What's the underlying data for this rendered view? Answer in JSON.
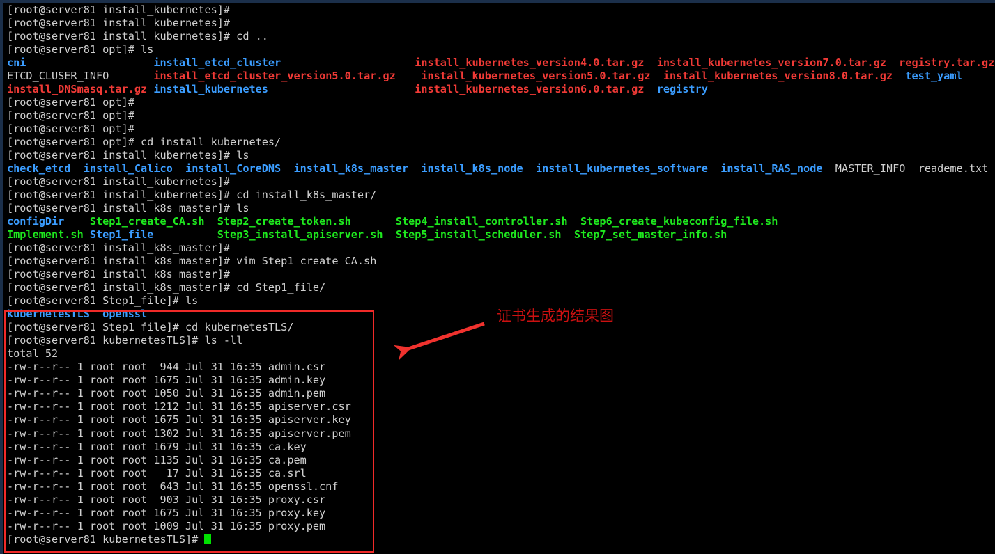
{
  "terminal": {
    "background_color": "#000000",
    "default_text_color": "#d0d0d0",
    "dir_color": "#3b9dff",
    "archive_color": "#f03a36",
    "exec_color": "#1ee81e",
    "cursor_color": "#00e000",
    "prompt_user_host": "[root@server81",
    "lines": [
      {
        "id": 1,
        "segments": [
          {
            "text": "[root@server81 install_kubernetes]#",
            "color": "white"
          }
        ]
      },
      {
        "id": 2,
        "segments": [
          {
            "text": "[root@server81 install_kubernetes]#",
            "color": "white"
          }
        ]
      },
      {
        "id": 3,
        "segments": [
          {
            "text": "[root@server81 install_kubernetes]# cd ..",
            "color": "white"
          }
        ]
      },
      {
        "id": 4,
        "segments": [
          {
            "text": "[root@server81 opt]# ls",
            "color": "white"
          }
        ]
      },
      {
        "id": 5,
        "segments": [
          {
            "text": "cni",
            "color": "blue"
          },
          {
            "text": "                    ",
            "color": "white"
          },
          {
            "text": "install_etcd_cluster",
            "color": "blue"
          },
          {
            "text": "                     ",
            "color": "white"
          },
          {
            "text": "install_kubernetes_version4.0.tar.gz",
            "color": "red"
          },
          {
            "text": "  ",
            "color": "white"
          },
          {
            "text": "install_kubernetes_version7.0.tar.gz",
            "color": "red"
          },
          {
            "text": "  ",
            "color": "white"
          },
          {
            "text": "registry.tar.gz",
            "color": "red"
          }
        ]
      },
      {
        "id": 6,
        "segments": [
          {
            "text": "ETCD_CLUSER_INFO",
            "color": "white"
          },
          {
            "text": "       ",
            "color": "white"
          },
          {
            "text": "install_etcd_cluster_version5.0.tar.gz",
            "color": "red"
          },
          {
            "text": "    ",
            "color": "white"
          },
          {
            "text": "install_kubernetes_version5.0.tar.gz",
            "color": "red"
          },
          {
            "text": "  ",
            "color": "white"
          },
          {
            "text": "install_kubernetes_version8.0.tar.gz",
            "color": "red"
          },
          {
            "text": "  ",
            "color": "white"
          },
          {
            "text": "test_yaml",
            "color": "blue"
          }
        ]
      },
      {
        "id": 7,
        "segments": [
          {
            "text": "install_DNSmasq.tar.gz",
            "color": "red"
          },
          {
            "text": " ",
            "color": "white"
          },
          {
            "text": "install_kubernetes",
            "color": "blue"
          },
          {
            "text": "                       ",
            "color": "white"
          },
          {
            "text": "install_kubernetes_version6.0.tar.gz",
            "color": "red"
          },
          {
            "text": "  ",
            "color": "white"
          },
          {
            "text": "registry",
            "color": "blue"
          }
        ]
      },
      {
        "id": 8,
        "segments": [
          {
            "text": "[root@server81 opt]#",
            "color": "white"
          }
        ]
      },
      {
        "id": 9,
        "segments": [
          {
            "text": "[root@server81 opt]#",
            "color": "white"
          }
        ]
      },
      {
        "id": 10,
        "segments": [
          {
            "text": "[root@server81 opt]#",
            "color": "white"
          }
        ]
      },
      {
        "id": 11,
        "segments": [
          {
            "text": "[root@server81 opt]# cd install_kubernetes/",
            "color": "white"
          }
        ]
      },
      {
        "id": 12,
        "segments": [
          {
            "text": "[root@server81 install_kubernetes]# ls",
            "color": "white"
          }
        ]
      },
      {
        "id": 13,
        "segments": [
          {
            "text": "check_etcd",
            "color": "blue"
          },
          {
            "text": "  ",
            "color": "white"
          },
          {
            "text": "install_Calico",
            "color": "blue"
          },
          {
            "text": "  ",
            "color": "white"
          },
          {
            "text": "install_CoreDNS",
            "color": "blue"
          },
          {
            "text": "  ",
            "color": "white"
          },
          {
            "text": "install_k8s_master",
            "color": "blue"
          },
          {
            "text": "  ",
            "color": "white"
          },
          {
            "text": "install_k8s_node",
            "color": "blue"
          },
          {
            "text": "  ",
            "color": "white"
          },
          {
            "text": "install_kubernetes_software",
            "color": "blue"
          },
          {
            "text": "  ",
            "color": "white"
          },
          {
            "text": "install_RAS_node",
            "color": "blue"
          },
          {
            "text": "  ",
            "color": "white"
          },
          {
            "text": "MASTER_INFO",
            "color": "white"
          },
          {
            "text": "  ",
            "color": "white"
          },
          {
            "text": "reademe.txt",
            "color": "white"
          }
        ]
      },
      {
        "id": 14,
        "segments": [
          {
            "text": "[root@server81 install_kubernetes]#",
            "color": "white"
          }
        ]
      },
      {
        "id": 15,
        "segments": [
          {
            "text": "[root@server81 install_kubernetes]# cd install_k8s_master/",
            "color": "white"
          }
        ]
      },
      {
        "id": 16,
        "segments": [
          {
            "text": "[root@server81 install_k8s_master]# ls",
            "color": "white"
          }
        ]
      },
      {
        "id": 17,
        "segments": [
          {
            "text": "configDir",
            "color": "blue"
          },
          {
            "text": "    ",
            "color": "white"
          },
          {
            "text": "Step1_create_CA.sh",
            "color": "green"
          },
          {
            "text": "  ",
            "color": "white"
          },
          {
            "text": "Step2_create_token.sh",
            "color": "green"
          },
          {
            "text": "       ",
            "color": "white"
          },
          {
            "text": "Step4_install_controller.sh",
            "color": "green"
          },
          {
            "text": "  ",
            "color": "white"
          },
          {
            "text": "Step6_create_kubeconfig_file.sh",
            "color": "green"
          }
        ]
      },
      {
        "id": 18,
        "segments": [
          {
            "text": "Implement.sh",
            "color": "green"
          },
          {
            "text": " ",
            "color": "white"
          },
          {
            "text": "Step1_file",
            "color": "blue"
          },
          {
            "text": "          ",
            "color": "white"
          },
          {
            "text": "Step3_install_apiserver.sh",
            "color": "green"
          },
          {
            "text": "  ",
            "color": "white"
          },
          {
            "text": "Step5_install_scheduler.sh",
            "color": "green"
          },
          {
            "text": "  ",
            "color": "white"
          },
          {
            "text": "Step7_set_master_info.sh",
            "color": "green"
          }
        ]
      },
      {
        "id": 19,
        "segments": [
          {
            "text": "[root@server81 install_k8s_master]#",
            "color": "white"
          }
        ]
      },
      {
        "id": 20,
        "segments": [
          {
            "text": "[root@server81 install_k8s_master]# vim Step1_create_CA.sh",
            "color": "white"
          }
        ]
      },
      {
        "id": 21,
        "segments": [
          {
            "text": "[root@server81 install_k8s_master]#",
            "color": "white"
          }
        ]
      },
      {
        "id": 22,
        "segments": [
          {
            "text": "[root@server81 install_k8s_master]# cd Step1_file/",
            "color": "white"
          }
        ]
      },
      {
        "id": 23,
        "segments": [
          {
            "text": "[root@server81 Step1_file]# ls",
            "color": "white"
          }
        ]
      },
      {
        "id": 24,
        "segments": [
          {
            "text": "kubernetesTLS",
            "color": "blue"
          },
          {
            "text": "  ",
            "color": "white"
          },
          {
            "text": "openssl",
            "color": "blue"
          }
        ]
      },
      {
        "id": 25,
        "segments": [
          {
            "text": "[root@server81 Step1_file]# cd kubernetesTLS/",
            "color": "white"
          }
        ]
      },
      {
        "id": 26,
        "segments": [
          {
            "text": "[root@server81 kubernetesTLS]# ls -ll",
            "color": "white"
          }
        ]
      },
      {
        "id": 27,
        "segments": [
          {
            "text": "total 52",
            "color": "white"
          }
        ]
      },
      {
        "id": 28,
        "segments": [
          {
            "text": "-rw-r--r-- 1 root root  944 Jul 31 16:35 admin.csr",
            "color": "white"
          }
        ]
      },
      {
        "id": 29,
        "segments": [
          {
            "text": "-rw-r--r-- 1 root root 1675 Jul 31 16:35 admin.key",
            "color": "white"
          }
        ]
      },
      {
        "id": 30,
        "segments": [
          {
            "text": "-rw-r--r-- 1 root root 1050 Jul 31 16:35 admin.pem",
            "color": "white"
          }
        ]
      },
      {
        "id": 31,
        "segments": [
          {
            "text": "-rw-r--r-- 1 root root 1212 Jul 31 16:35 apiserver.csr",
            "color": "white"
          }
        ]
      },
      {
        "id": 32,
        "segments": [
          {
            "text": "-rw-r--r-- 1 root root 1675 Jul 31 16:35 apiserver.key",
            "color": "white"
          }
        ]
      },
      {
        "id": 33,
        "segments": [
          {
            "text": "-rw-r--r-- 1 root root 1302 Jul 31 16:35 apiserver.pem",
            "color": "white"
          }
        ]
      },
      {
        "id": 34,
        "segments": [
          {
            "text": "-rw-r--r-- 1 root root 1679 Jul 31 16:35 ca.key",
            "color": "white"
          }
        ]
      },
      {
        "id": 35,
        "segments": [
          {
            "text": "-rw-r--r-- 1 root root 1135 Jul 31 16:35 ca.pem",
            "color": "white"
          }
        ]
      },
      {
        "id": 36,
        "segments": [
          {
            "text": "-rw-r--r-- 1 root root   17 Jul 31 16:35 ca.srl",
            "color": "white"
          }
        ]
      },
      {
        "id": 37,
        "segments": [
          {
            "text": "-rw-r--r-- 1 root root  643 Jul 31 16:35 openssl.cnf",
            "color": "white"
          }
        ]
      },
      {
        "id": 38,
        "segments": [
          {
            "text": "-rw-r--r-- 1 root root  903 Jul 31 16:35 proxy.csr",
            "color": "white"
          }
        ]
      },
      {
        "id": 39,
        "segments": [
          {
            "text": "-rw-r--r-- 1 root root 1675 Jul 31 16:35 proxy.key",
            "color": "white"
          }
        ]
      },
      {
        "id": 40,
        "segments": [
          {
            "text": "-rw-r--r-- 1 root root 1009 Jul 31 16:35 proxy.pem",
            "color": "white"
          }
        ]
      },
      {
        "id": 41,
        "segments": [
          {
            "text": "[root@server81 kubernetesTLS]# ",
            "color": "white"
          }
        ],
        "cursor": true
      }
    ]
  },
  "annotations": {
    "caption_text": "证书生成的结果图",
    "caption_color": "#cc1111",
    "box_color": "#f02a28",
    "arrow_color": "#f0322e"
  }
}
